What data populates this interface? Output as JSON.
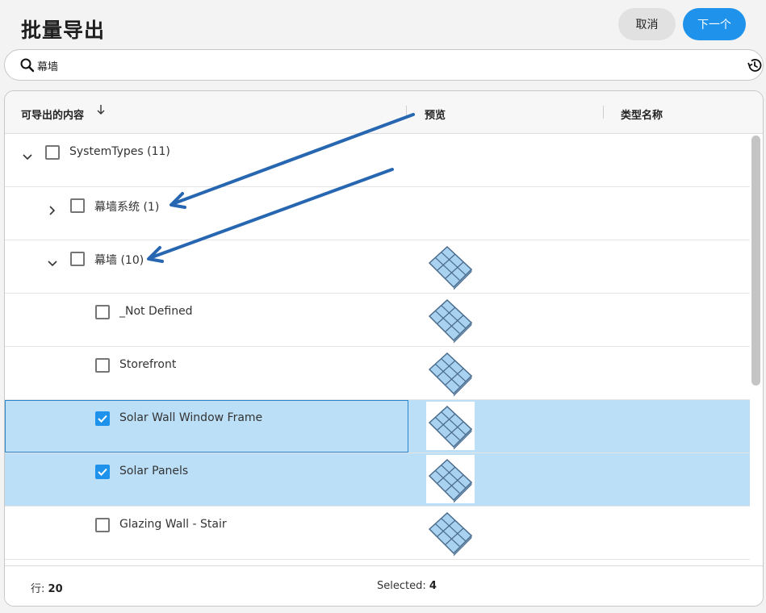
{
  "header": {
    "title": "批量导出",
    "cancel_label": "取消",
    "next_label": "下一个"
  },
  "search": {
    "value": "幕墙"
  },
  "table": {
    "columns": [
      "可导出的内容",
      "预览",
      "类型名称"
    ],
    "rows": [
      {
        "label": "SystemTypes (11)",
        "level": 0,
        "expanded": true,
        "checked": false,
        "preview": false
      },
      {
        "label": "幕墙系统 (1)",
        "level": 1,
        "expanded": false,
        "checked": false,
        "preview": false
      },
      {
        "label": "幕墙 (10)",
        "level": 1,
        "expanded": true,
        "checked": false,
        "preview": true
      },
      {
        "label": "_Not Defined",
        "level": 2,
        "checked": false,
        "preview": true
      },
      {
        "label": "Storefront",
        "level": 2,
        "checked": false,
        "preview": true
      },
      {
        "label": "Solar Wall Window Frame",
        "level": 2,
        "checked": true,
        "preview": true
      },
      {
        "label": "Solar Panels",
        "level": 2,
        "checked": true,
        "preview": true
      },
      {
        "label": "Glazing Wall - Stair",
        "level": 2,
        "checked": false,
        "preview": true
      }
    ]
  },
  "footer": {
    "rows_label": "行:",
    "rows_count": "20",
    "selected_label": "Selected:",
    "selected_count": "4"
  },
  "colors": {
    "accent": "#1f93ec",
    "selected_row": "#bcdff8",
    "annotation_arrow": "#2766b0"
  },
  "icons": [
    "search-icon",
    "history-icon",
    "sort-down-arrow-icon",
    "chevron-down-icon",
    "chevron-right-icon",
    "checkbox-icon",
    "curtain-wall-preview-icon"
  ]
}
